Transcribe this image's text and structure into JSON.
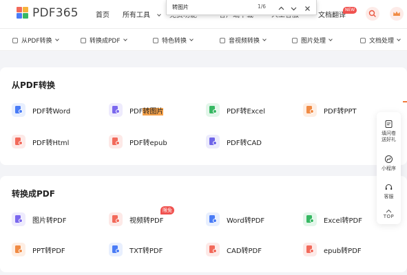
{
  "header": {
    "logo_text": "PDF365",
    "nav": [
      {
        "label": "首页"
      },
      {
        "label": "所有工具"
      },
      {
        "label": "免费功能"
      },
      {
        "label": "客户端下载"
      },
      {
        "label": "人工客服"
      },
      {
        "label": "文档翻译"
      }
    ],
    "new_badge": "NEW"
  },
  "find_bar": {
    "query": "转图片",
    "count": "1/6"
  },
  "subnav": [
    {
      "label": "从PDF转换"
    },
    {
      "label": "转换成PDF"
    },
    {
      "label": "特色转换"
    },
    {
      "label": "音视频转换"
    },
    {
      "label": "图片处理"
    },
    {
      "label": "文档处理"
    }
  ],
  "sections": [
    {
      "title": "从PDF转换",
      "tools": [
        {
          "label": "PDF转Word",
          "color": "#4a7cf6",
          "bg": "#e8effe"
        },
        {
          "label_pre": "PDF",
          "label_hl": "转图片",
          "color": "#7b68ee",
          "bg": "#eeebfd"
        },
        {
          "label": "PDF转Excel",
          "color": "#37b863",
          "bg": "#e3f6ea"
        },
        {
          "label": "PDF转PPT",
          "color": "#f08b45",
          "bg": "#feeee3"
        },
        {
          "label": "PDF转Html",
          "color": "#f26a5b",
          "bg": "#fde9e7"
        },
        {
          "label": "PDF转epub",
          "color": "#f26a5b",
          "bg": "#fde9e7"
        },
        {
          "label": "PDF转CAD",
          "color": "#6f65e8",
          "bg": "#ecebfc"
        }
      ]
    },
    {
      "title": "转换成PDF",
      "tools": [
        {
          "label": "图片转PDF",
          "color": "#7b68ee",
          "bg": "#eeebfd"
        },
        {
          "label": "视频转PDF",
          "color": "#f26a5b",
          "bg": "#fde9e7",
          "badge": "限免"
        },
        {
          "label": "Word转PDF",
          "color": "#4a7cf6",
          "bg": "#e8effe"
        },
        {
          "label": "Excel转PDF",
          "color": "#37b863",
          "bg": "#e3f6ea"
        },
        {
          "label": "PPT转PDF",
          "color": "#f08b45",
          "bg": "#feeee3"
        },
        {
          "label": "TXT转PDF",
          "color": "#4a7cf6",
          "bg": "#e8effe"
        },
        {
          "label": "CAD转PDF",
          "color": "#f26a5b",
          "bg": "#fde9e7"
        },
        {
          "label": "epub转PDF",
          "color": "#f26a5b",
          "bg": "#fde9e7"
        }
      ]
    }
  ],
  "float_panel": {
    "survey": "填问卷送好礼",
    "mini": "小程序",
    "service": "客服",
    "top": "TOP"
  },
  "colors": {
    "accent": "#f0524f",
    "highlight": "#f5a24b"
  }
}
